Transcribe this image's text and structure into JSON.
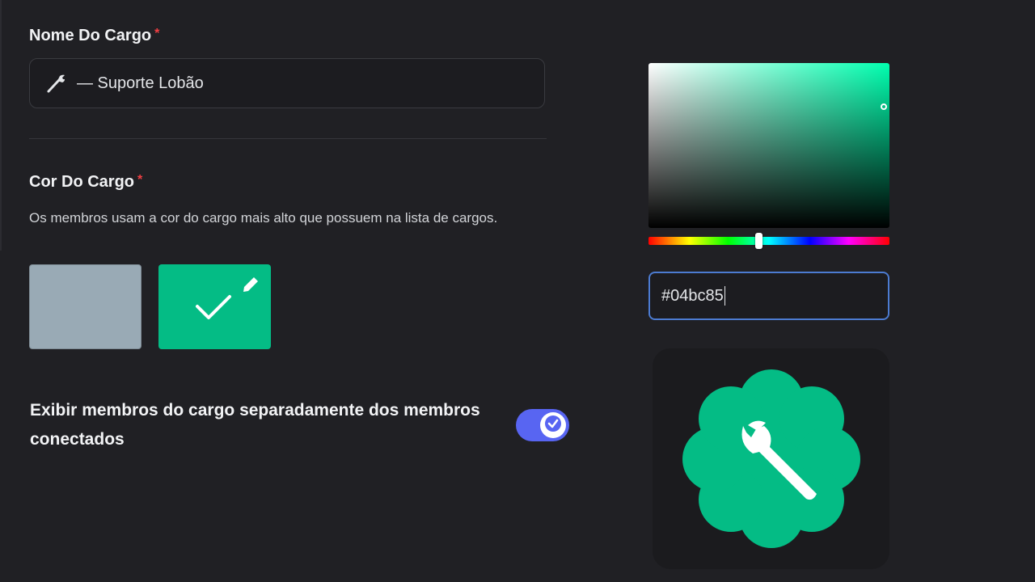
{
  "role_name": {
    "label": "Nome Do Cargo",
    "required_mark": "*",
    "icon": "wrench-icon",
    "value": "— Suporte Lobão"
  },
  "role_color": {
    "label": "Cor Do Cargo",
    "required_mark": "*",
    "description": "Os membros usam a cor do cargo mais alto que possuem na lista de cargos.",
    "default_swatch_color": "#99aab5",
    "custom_swatch_color": "#04bc85",
    "selected": "custom"
  },
  "display_separately": {
    "label": "Exibir membros do cargo separadamente dos membros conectados",
    "enabled": true,
    "toggle_color": "#5865f2"
  },
  "color_picker": {
    "hex_value": "#04bc85",
    "hue_color": "#00ffaf"
  },
  "role_icon_preview": {
    "icon": "wrench-icon",
    "badge_color": "#04bc85"
  }
}
